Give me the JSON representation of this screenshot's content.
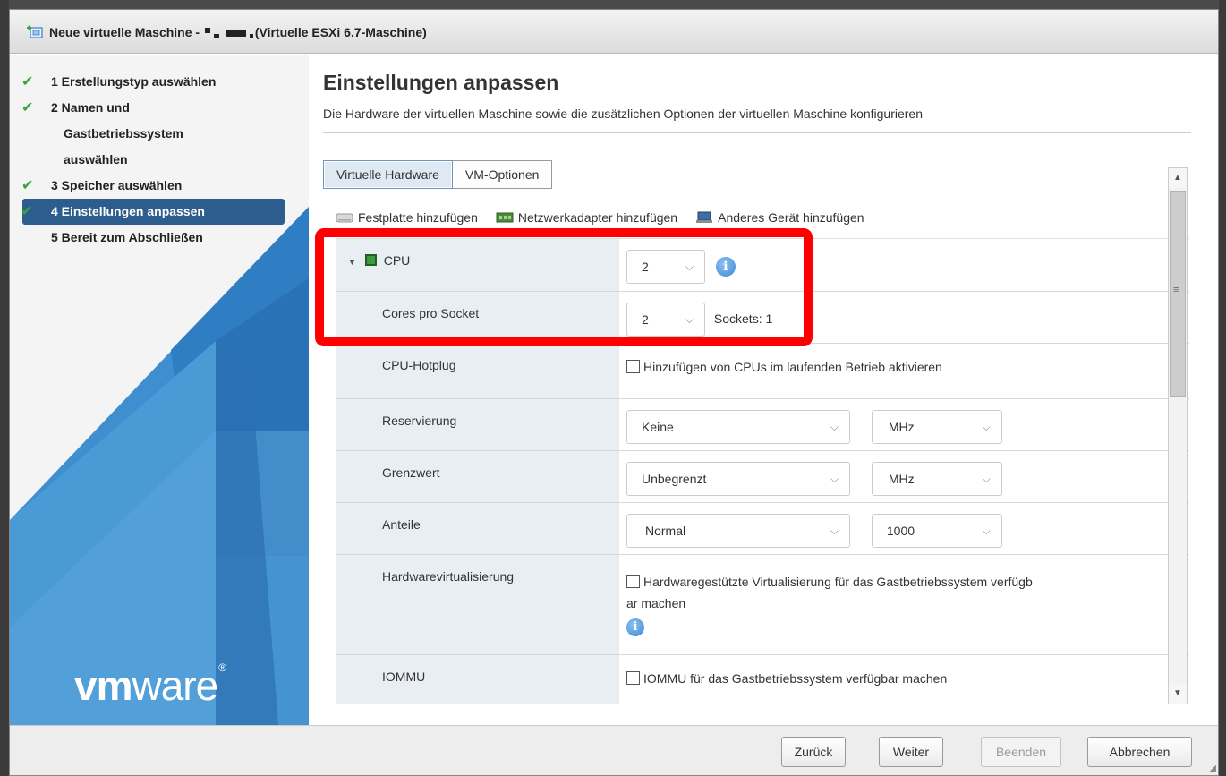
{
  "window": {
    "title_prefix": "Neue virtuelle Maschine -",
    "title_suffix": "(Virtuelle ESXi 6.7-Maschine)"
  },
  "sidebar": {
    "steps": [
      {
        "label": "1 Erstellungstyp auswählen",
        "done": true
      },
      {
        "label": "2 Namen und",
        "label_line2": "Gastbetriebssystem",
        "label_line3": "auswählen",
        "done": true
      },
      {
        "label": "3 Speicher auswählen",
        "done": true
      },
      {
        "label": "4 Einstellungen anpassen",
        "done": true,
        "active": true
      },
      {
        "label": "5 Bereit zum Abschließen",
        "done": false
      }
    ],
    "logo_bold": "vm",
    "logo_rest": "ware",
    "logo_reg": "®"
  },
  "main": {
    "title": "Einstellungen anpassen",
    "subtitle": "Die Hardware der virtuellen Maschine sowie die zusätzlichen Optionen der virtuellen Maschine konfigurieren",
    "tabs": [
      {
        "label": "Virtuelle Hardware",
        "active": true
      },
      {
        "label": "VM-Optionen",
        "active": false
      }
    ],
    "toolbar": {
      "add_disk": "Festplatte hinzufügen",
      "add_network": "Netzwerkadapter hinzufügen",
      "add_other": "Anderes Gerät hinzufügen"
    },
    "rows": {
      "cpu": {
        "label": "CPU",
        "value": "2"
      },
      "cores": {
        "label": "Cores pro Socket",
        "value": "2",
        "sockets": "Sockets: 1"
      },
      "hotplug": {
        "label": "CPU-Hotplug",
        "checkbox_label": "Hinzufügen von CPUs im laufenden Betrieb aktivieren"
      },
      "reservation": {
        "label": "Reservierung",
        "value": "Keine",
        "unit": "MHz"
      },
      "limit": {
        "label": "Grenzwert",
        "value": "Unbegrenzt",
        "unit": "MHz"
      },
      "shares": {
        "label": "Anteile",
        "value": "Normal",
        "amount": "1000"
      },
      "hwvirt": {
        "label": "Hardwarevirtualisierung",
        "checkbox_label_line1": "Hardwaregestützte Virtualisierung für das Gastbetriebssystem verfügb",
        "checkbox_label_line2": "ar machen"
      },
      "iommu": {
        "label": "IOMMU",
        "checkbox_label": "IOMMU für das Gastbetriebssystem verfügbar machen"
      }
    }
  },
  "footer": {
    "back": "Zurück",
    "next": "Weiter",
    "finish": "Beenden",
    "cancel": "Abbrechen"
  },
  "colors": {
    "highlight": "#ff0000",
    "active_step": "#2c5d8c",
    "check": "#3aa23a",
    "info": "#3b87d2"
  },
  "icons": {
    "info": "i",
    "chevron_down": "⌵",
    "check": "✔"
  }
}
